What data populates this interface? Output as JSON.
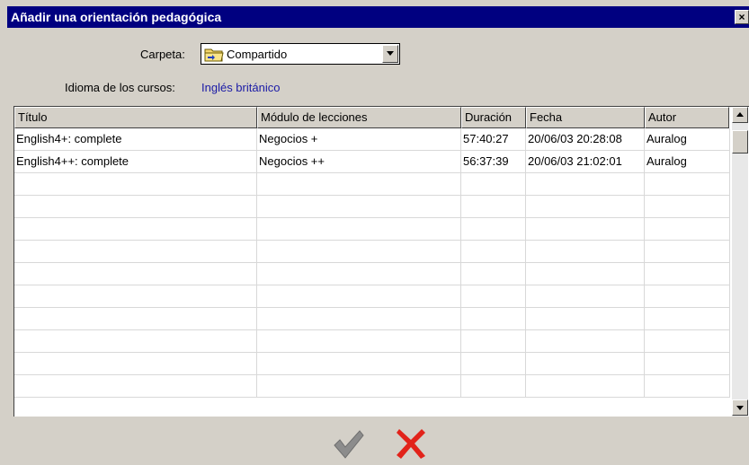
{
  "window": {
    "title": "Añadir una orientación pedagógica",
    "close_glyph": "×"
  },
  "folder": {
    "label": "Carpeta:",
    "value": "Compartido",
    "icon": "shared-folder-icon"
  },
  "language": {
    "label": "Idioma de los cursos:",
    "value": "Inglés británico"
  },
  "table": {
    "columns": [
      "Título",
      "Módulo de lecciones",
      "Duración",
      "Fecha",
      "Autor"
    ],
    "rows": [
      [
        "English4+: complete",
        "Negocios +",
        "57:40:27",
        "20/06/03 20:28:08",
        "Auralog"
      ],
      [
        "English4++: complete",
        "Negocios ++",
        "56:37:39",
        "20/06/03 21:02:01",
        "Auralog"
      ]
    ],
    "empty_row_count": 10
  },
  "actions": {
    "ok_icon": "check-icon",
    "cancel_icon": "red-x-icon"
  },
  "colors": {
    "titlebar": "#000080",
    "language_value": "#1a1aa6",
    "cancel": "#e2231a",
    "check": "#8c8c8c"
  }
}
